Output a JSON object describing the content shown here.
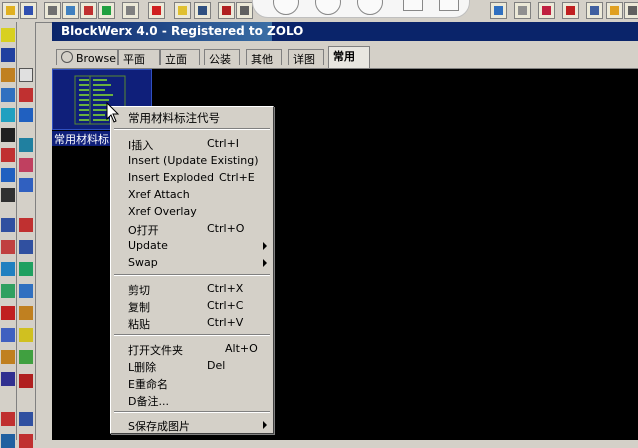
{
  "window": {
    "title": "BlockWerx 4.0 - Registered to ZOLO"
  },
  "tabs": [
    {
      "label": "Browse"
    },
    {
      "label": "平面"
    },
    {
      "label": "立面"
    },
    {
      "label": "公装"
    },
    {
      "label": "其他"
    },
    {
      "label": "详图"
    },
    {
      "label": "常用"
    }
  ],
  "active_tab": "常用",
  "thumbnail": {
    "label": "常用材料标"
  },
  "context_menu": {
    "header": "常用材料标注代号",
    "groups": [
      [
        {
          "label": "I插入",
          "shortcut": "Ctrl+I"
        },
        {
          "label": "Insert (Update Existing)",
          "shortcut": ""
        },
        {
          "label": "Insert Exploded",
          "shortcut": "Ctrl+E"
        },
        {
          "label": "Xref Attach",
          "shortcut": ""
        },
        {
          "label": "Xref Overlay",
          "shortcut": ""
        },
        {
          "label": "O打开",
          "shortcut": "Ctrl+O"
        },
        {
          "label": "Update",
          "shortcut": "",
          "submenu": true
        },
        {
          "label": "Swap",
          "shortcut": "",
          "submenu": true
        }
      ],
      [
        {
          "label": "剪切",
          "shortcut": "Ctrl+X"
        },
        {
          "label": "复制",
          "shortcut": "Ctrl+C"
        },
        {
          "label": "粘贴",
          "shortcut": "Ctrl+V"
        }
      ],
      [
        {
          "label": "打开文件夹",
          "shortcut": "Alt+O"
        },
        {
          "label": "L删除",
          "shortcut": "Del"
        },
        {
          "label": "E重命名",
          "shortcut": ""
        },
        {
          "label": "D备注...",
          "shortcut": ""
        }
      ],
      [
        {
          "label": "S保存成图片",
          "shortcut": "",
          "submenu": true
        }
      ]
    ]
  },
  "colors": {
    "titlebar": "#0a246a",
    "canvas": "#000000",
    "thumbnail_bg": "#0f1f7a",
    "menu_bg": "#d4d0c8"
  },
  "icons": {
    "video_back": "rewind-icon",
    "video_pause": "pause-icon",
    "video_forward": "forward-icon"
  }
}
